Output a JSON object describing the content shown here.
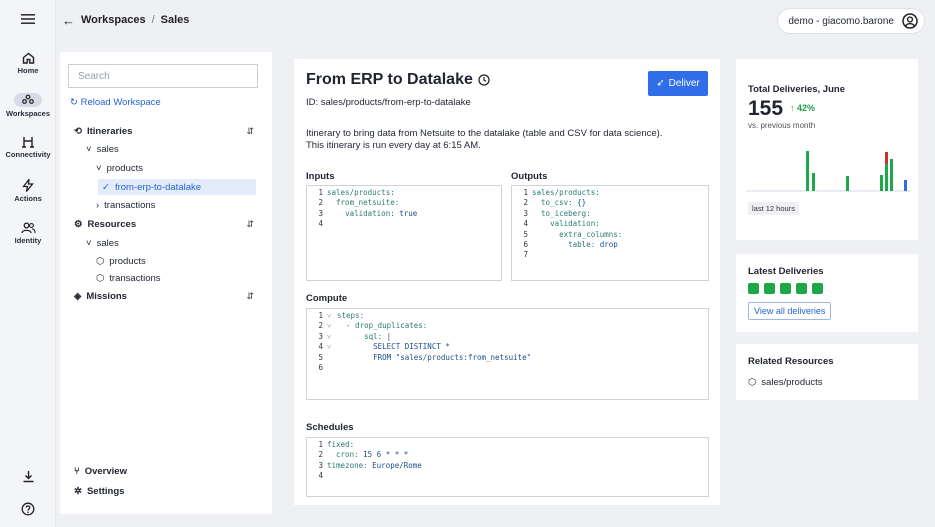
{
  "rail": {
    "home": "Home",
    "workspaces": "Workspaces",
    "connectivity": "Connectivity",
    "actions": "Actions",
    "identity": "Identity"
  },
  "breadcrumb": {
    "workspaces": "Workspaces",
    "sep": "/",
    "current": "Sales"
  },
  "user": {
    "label": "demo - giacomo.barone"
  },
  "left": {
    "search_placeholder": "Search",
    "reload": "Reload Workspace",
    "itineraries": "Itineraries",
    "sales": "sales",
    "products": "products",
    "selected": "from-erp-to-datalake",
    "transactions": "transactions",
    "resources": "Resources",
    "res_sales": "sales",
    "res_products": "products",
    "res_transactions": "transactions",
    "missions": "Missions",
    "overview": "Overview",
    "settings": "Settings"
  },
  "main": {
    "title": "From ERP to Datalake",
    "id": "ID: sales/products/from-erp-to-datalake",
    "deliver": "Deliver",
    "desc1": "Itinerary to bring data from Netsuite to the datalake (table and CSV for data science).",
    "desc2": "This itinerary is run every day at 6:15 AM.",
    "inputs": "Inputs",
    "outputs": "Outputs",
    "compute": "Compute",
    "schedules": "Schedules"
  },
  "inputs_code": [
    "sales/products:",
    "  from_netsuite:",
    "    validation: true",
    ""
  ],
  "outputs_code": [
    "sales/products:",
    "  to_csv: {}",
    "  to_iceberg:",
    "    validation:",
    "      extra_columns:",
    "        table: drop",
    ""
  ],
  "compute_code": [
    "steps:",
    "  - drop_duplicates:",
    "      sql: |",
    "        SELECT DISTINCT *",
    "        FROM \"sales/products:from_netsuite\"",
    ""
  ],
  "schedules_code": [
    "fixed:",
    "  cron: 15 6 * * *",
    "timezone: Europe/Rome",
    ""
  ],
  "stats": {
    "title": "Total Deliveries, June",
    "value": "155",
    "trend": "↑ 42%",
    "sub": "vs. previous month",
    "range": "last 12 hours"
  },
  "latest": {
    "title": "Latest Deliveries",
    "button": "View all deliveries"
  },
  "related": {
    "title": "Related Resources",
    "item": "sales/products"
  },
  "colors": {
    "accent": "#2f6ee8",
    "success": "#1fa84a",
    "error": "#c0392b"
  }
}
